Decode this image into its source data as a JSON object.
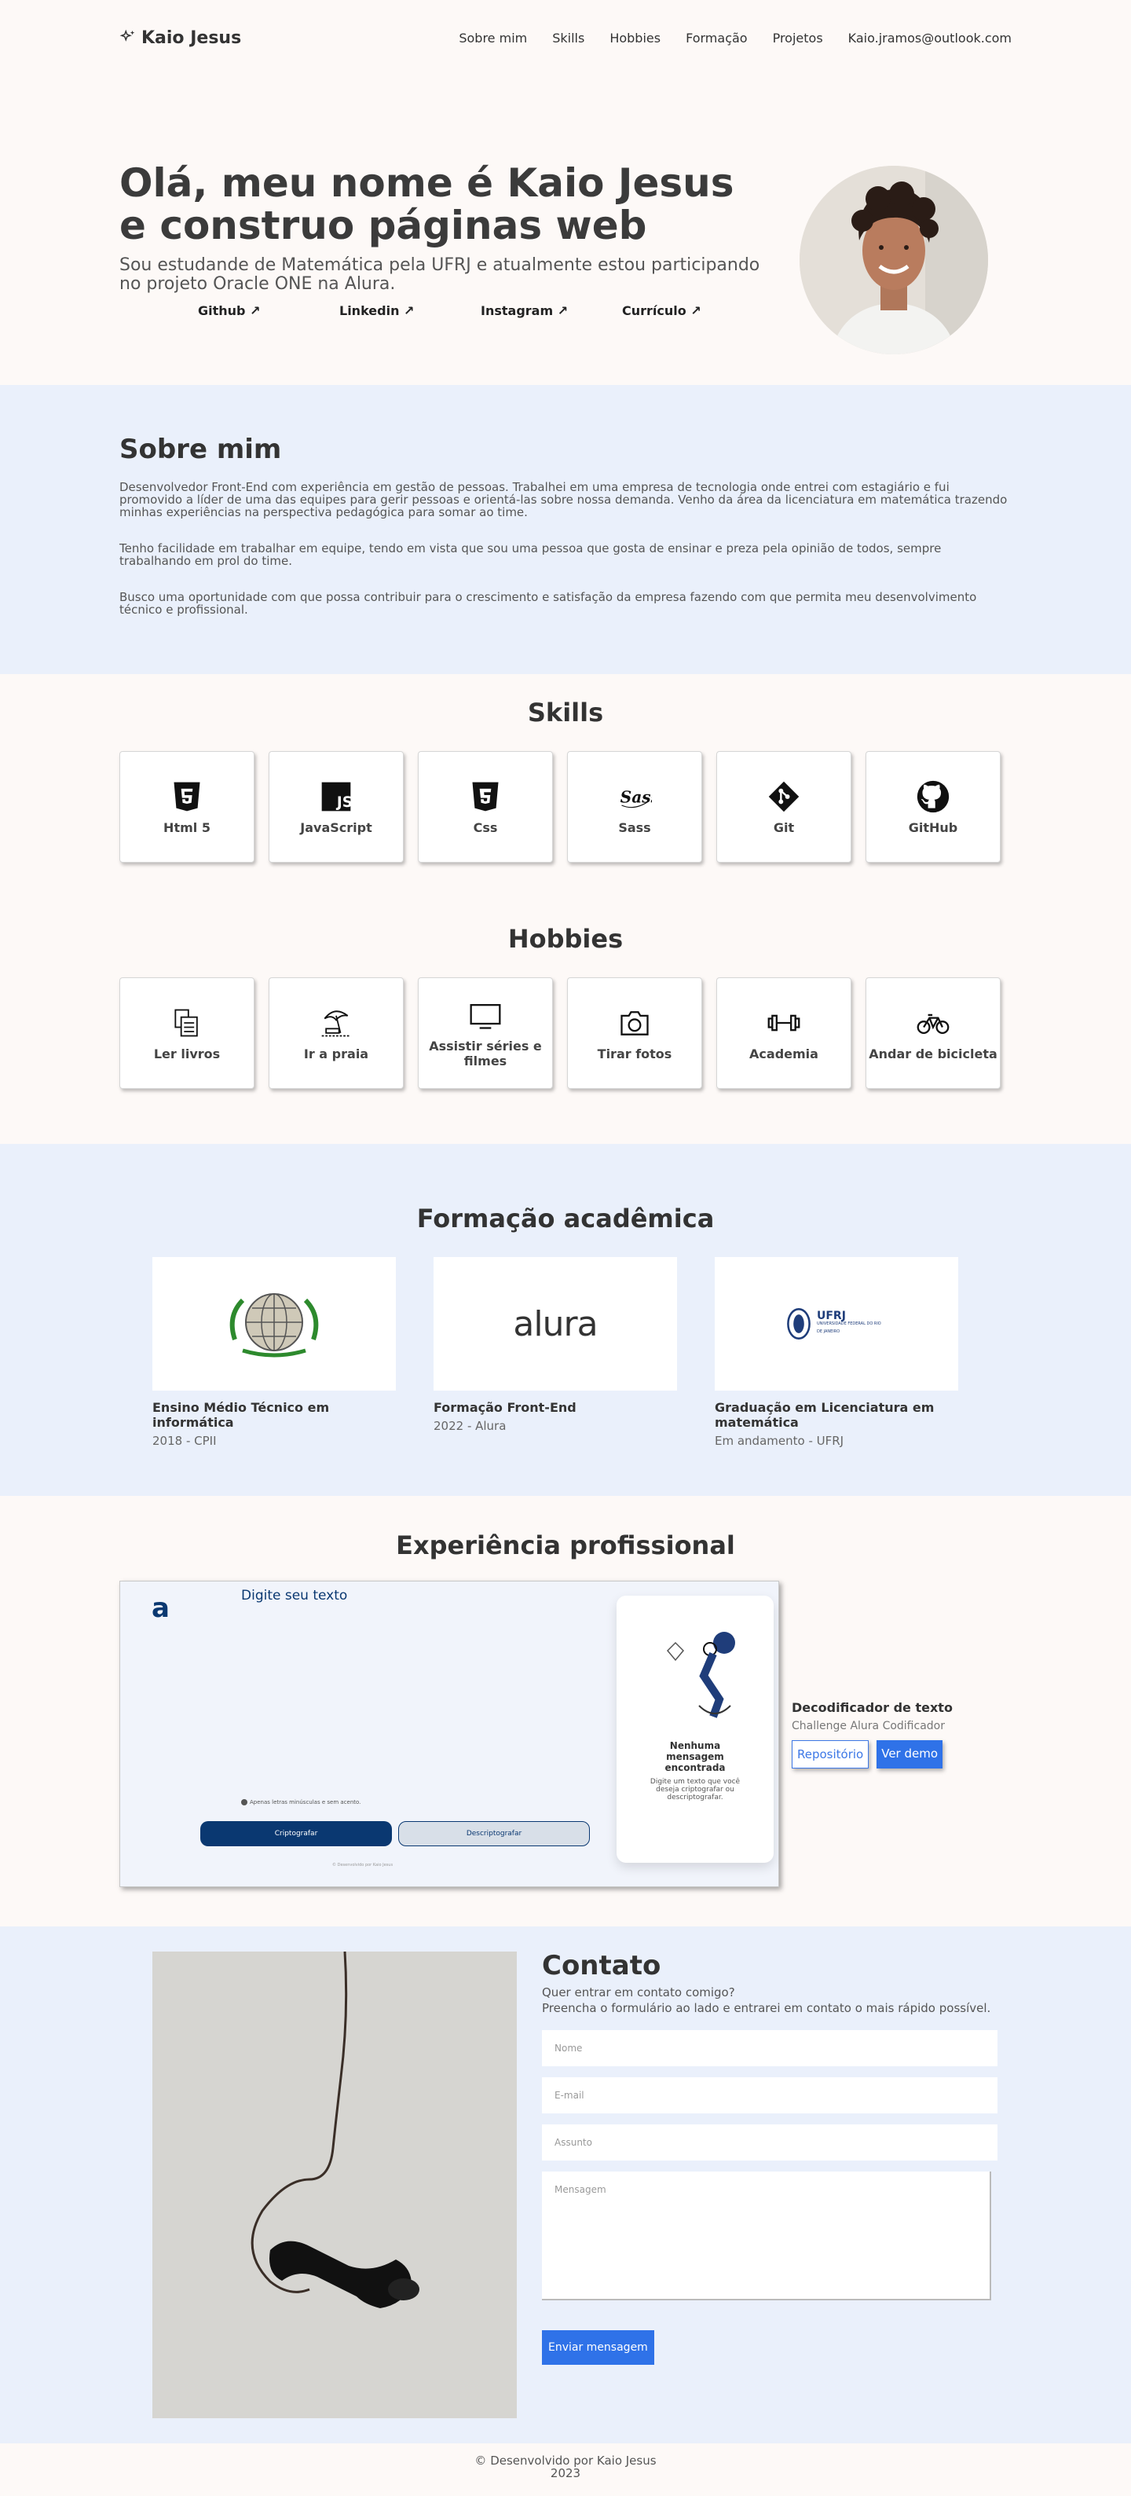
{
  "header": {
    "brand": "Kaio Jesus",
    "nav": [
      "Sobre mim",
      "Skills",
      "Hobbies",
      "Formação",
      "Projetos",
      "Kaio.jramos@outlook.com"
    ]
  },
  "hero": {
    "title": "Olá, meu nome é Kaio Jesus e construo páginas web",
    "subtitle": "Sou estudande de Matemática pela UFRJ e atualmente estou participando no projeto Oracle ONE na Alura.",
    "links": [
      "Github ↗",
      "Linkedin ↗",
      "Instagram ↗",
      "Currículo ↗"
    ]
  },
  "about": {
    "title": "Sobre mim",
    "paragraphs": [
      "Desenvolvedor Front-End com experiência em gestão de pessoas. Trabalhei em uma empresa de tecnologia onde entrei com estagiário e fui promovido a líder de uma das equipes para gerir pessoas e orientá-las sobre nossa demanda. Venho da área da licenciatura em matemática trazendo minhas experiências na perspectiva pedagógica para somar ao time.",
      "Tenho facilidade em trabalhar em equipe, tendo em vista que sou uma pessoa que gosta de ensinar e preza pela opinião de todos, sempre trabalhando em prol do time.",
      "Busco uma oportunidade com que possa contribuir para o crescimento e satisfação da empresa fazendo com que permita meu desenvolvimento técnico e profissional."
    ]
  },
  "skills": {
    "title": "Skills",
    "items": [
      "Html 5",
      "JavaScript",
      "Css",
      "Sass",
      "Git",
      "GitHub"
    ],
    "icons": [
      "html5-icon",
      "javascript-icon",
      "css3-icon",
      "sass-icon",
      "git-icon",
      "github-icon"
    ]
  },
  "hobbies": {
    "title": "Hobbies",
    "items": [
      "Ler livros",
      "Ir a praia",
      "Assistir séries e filmes",
      "Tirar fotos",
      "Academia",
      "Andar de bicicleta"
    ],
    "icons": [
      "books-icon",
      "beach-icon",
      "tv-icon",
      "camera-icon",
      "dumbbell-icon",
      "bicycle-icon"
    ]
  },
  "education": {
    "title": "Formação acadêmica",
    "items": [
      {
        "title": "Ensino Médio Técnico em informática",
        "detail": "2018 - CPII"
      },
      {
        "title": "Formação Front-End",
        "detail": "2022 - Alura"
      },
      {
        "title": "Graduação em Licenciatura em matemática",
        "detail": "Em andamento - UFRJ"
      }
    ],
    "logo_alura": "alura",
    "logo_ufrj": "UFRJ",
    "logo_ufrj_sub": "UNIVERSIDADE FEDERAL DO RIO DE JANEIRO"
  },
  "experience": {
    "title": "Experiência profissional",
    "preview": {
      "logo": "a",
      "placeholder": "Digite seu texto",
      "hint": "Apenas letras minúsculas e sem acento.",
      "encrypt": "Criptografar",
      "decrypt": "Descriptografar",
      "empty_title": "Nenhuma mensagem encontrada",
      "empty_text": "Digite um texto que você deseja criptografar ou descriptografar.",
      "credit": "© Desenvolvido por Kaio Jesus"
    },
    "project": {
      "title": "Decodificador de texto",
      "subtitle": "Challenge Alura Codificador",
      "repo": "Repositório",
      "demo": "Ver demo"
    }
  },
  "contact": {
    "title": "Contato",
    "line1": "Quer entrar em contato comigo?",
    "line2": "Preencha o formulário ao lado e entrarei em contato o mais rápido possível.",
    "placeholders": {
      "name": "Nome",
      "email": "E-mail",
      "subject": "Assunto",
      "message": "Mensagem"
    },
    "send": "Enviar mensagem"
  },
  "footer": {
    "line1": "© Desenvolvido por Kaio Jesus",
    "line2": "2023"
  }
}
